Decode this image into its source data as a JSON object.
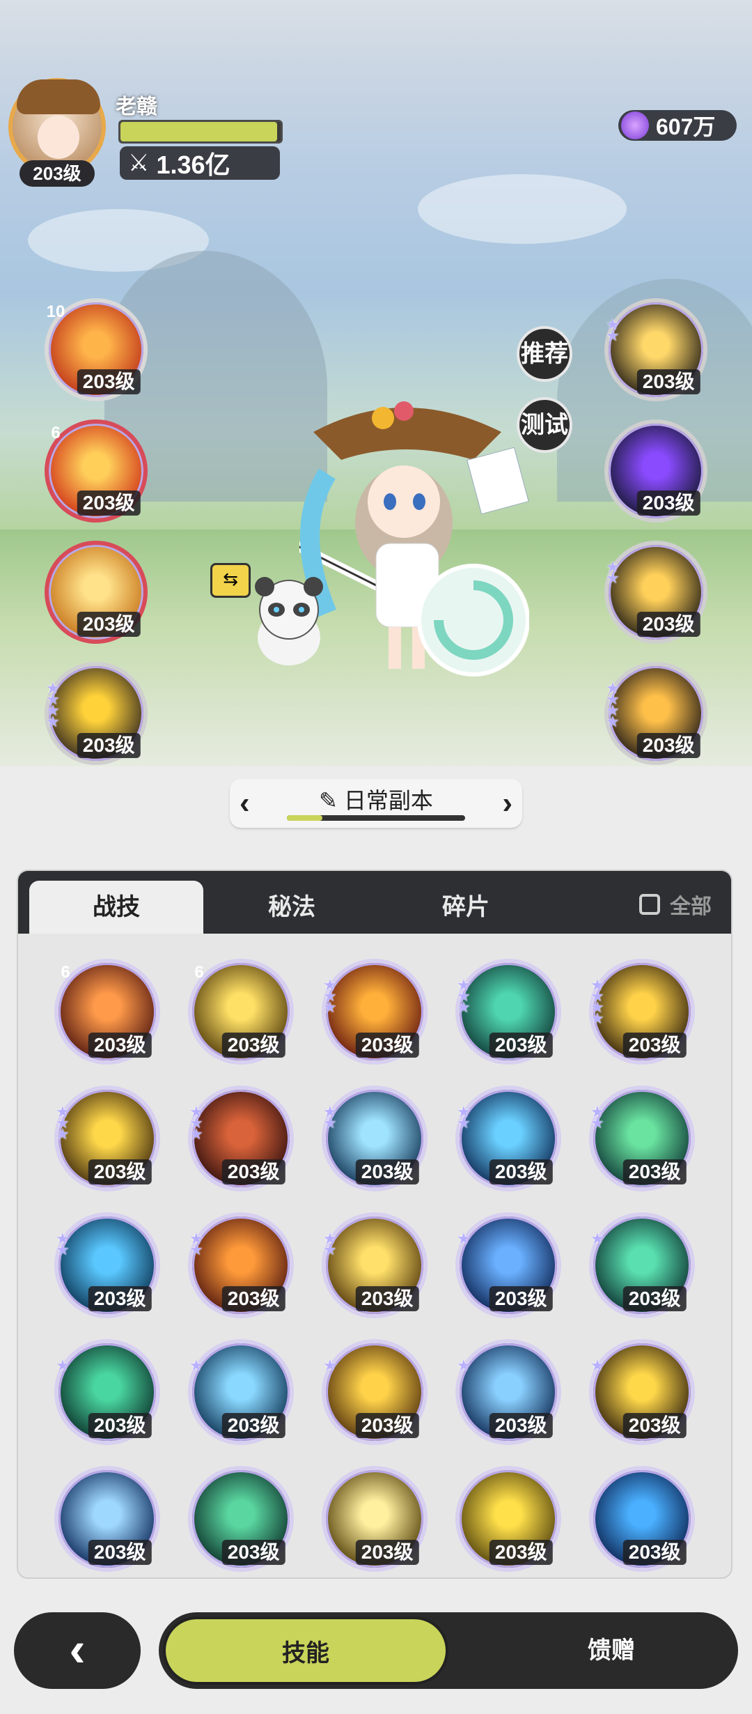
{
  "player": {
    "name": "老赣",
    "level": "203级",
    "power": "1.36亿",
    "hp_fraction": 0.98
  },
  "currency": {
    "amount": "607万"
  },
  "scene_buttons": {
    "recommend": "推荐",
    "test": "测试"
  },
  "left_skills": [
    {
      "level": "203级",
      "badge": "10",
      "badge_color": "#6a6fd8",
      "colors": [
        "#ffb44a",
        "#c0381a"
      ],
      "ring": "#d9d9d9"
    },
    {
      "level": "203级",
      "badge": "6",
      "badge_color": "#d0302a",
      "colors": [
        "#ffcf5a",
        "#d23a1a"
      ],
      "ring": "#d84b59"
    },
    {
      "level": "203级",
      "badge": "",
      "colors": [
        "#ffe28a",
        "#c8781e"
      ],
      "ring": "#d84b59"
    },
    {
      "level": "203级",
      "badge": "",
      "stars": 4,
      "colors": [
        "#ffd23a",
        "#3a2f20"
      ],
      "ring": "#cfcfcf"
    }
  ],
  "right_skills": [
    {
      "level": "203级",
      "stars": 2,
      "colors": [
        "#ffd86a",
        "#2b2418"
      ]
    },
    {
      "level": "203级",
      "stars": 0,
      "colors": [
        "#8a4bff",
        "#1a1a3a"
      ]
    },
    {
      "level": "203级",
      "stars": 2,
      "colors": [
        "#ffd05a",
        "#2a2416"
      ]
    },
    {
      "level": "203级",
      "stars": 4,
      "colors": [
        "#ffc04a",
        "#2a2218"
      ]
    }
  ],
  "dungeon": {
    "title": "日常副本",
    "progress_fraction": 0.2
  },
  "tabs": {
    "items": [
      "战技",
      "秘法",
      "碎片"
    ],
    "active": "战技",
    "all_label": "全部"
  },
  "grid_skills": [
    {
      "level": "203级",
      "badge": "6",
      "colors": [
        "#ff9a4a",
        "#5a1e12"
      ]
    },
    {
      "level": "203级",
      "badge": "6",
      "colors": [
        "#ffe066",
        "#5a4410"
      ]
    },
    {
      "level": "203级",
      "stars": 3,
      "colors": [
        "#ffb03a",
        "#6a1e10"
      ]
    },
    {
      "level": "203级",
      "stars": 3,
      "colors": [
        "#4fd6b0",
        "#12403a"
      ]
    },
    {
      "level": "203级",
      "stars": 4,
      "colors": [
        "#ffd24a",
        "#3a2a10"
      ]
    },
    {
      "level": "203级",
      "stars": 3,
      "colors": [
        "#ffd84a",
        "#4a3410"
      ]
    },
    {
      "level": "203级",
      "stars": 3,
      "colors": [
        "#d9633a",
        "#3a1410"
      ]
    },
    {
      "level": "203级",
      "stars": 2,
      "colors": [
        "#9fe3ff",
        "#163a5a"
      ]
    },
    {
      "level": "203级",
      "stars": 2,
      "colors": [
        "#6ad0ff",
        "#10305a"
      ]
    },
    {
      "level": "203级",
      "stars": 2,
      "colors": [
        "#6ae3a0",
        "#12403a"
      ]
    },
    {
      "level": "203级",
      "stars": 2,
      "colors": [
        "#5ac8ff",
        "#0e3a5a"
      ]
    },
    {
      "level": "203级",
      "stars": 2,
      "colors": [
        "#ff9a3a",
        "#5a1e10"
      ]
    },
    {
      "level": "203级",
      "stars": 2,
      "colors": [
        "#ffe06a",
        "#5a4010"
      ]
    },
    {
      "level": "203级",
      "stars": 1,
      "colors": [
        "#6ab0ff",
        "#102a5a"
      ]
    },
    {
      "level": "203级",
      "stars": 1,
      "colors": [
        "#5ae0b0",
        "#103a36"
      ]
    },
    {
      "level": "203级",
      "stars": 1,
      "colors": [
        "#4ad6a0",
        "#0e3a30"
      ]
    },
    {
      "level": "203级",
      "stars": 1,
      "colors": [
        "#8ad8ff",
        "#123a5a"
      ]
    },
    {
      "level": "203级",
      "stars": 1,
      "colors": [
        "#ffd24a",
        "#5a3a10"
      ]
    },
    {
      "level": "203级",
      "stars": 1,
      "colors": [
        "#8ad0ff",
        "#12305a"
      ]
    },
    {
      "level": "203级",
      "stars": 1,
      "colors": [
        "#ffd84a",
        "#3a2a10"
      ]
    },
    {
      "level": "203级",
      "stars": 0,
      "colors": [
        "#9fd8ff",
        "#123060"
      ]
    },
    {
      "level": "203级",
      "stars": 0,
      "colors": [
        "#5ad6a0",
        "#103a30"
      ]
    },
    {
      "level": "203级",
      "stars": 0,
      "colors": [
        "#fff0a0",
        "#5a4810"
      ]
    },
    {
      "level": "203级",
      "stars": 0,
      "colors": [
        "#ffe04a",
        "#5a4a10"
      ]
    },
    {
      "level": "203级",
      "stars": 0,
      "colors": [
        "#4ab0ff",
        "#0e2a5a"
      ]
    }
  ],
  "bottom_nav": {
    "active_label": "技能",
    "other_label": "馈赠"
  }
}
